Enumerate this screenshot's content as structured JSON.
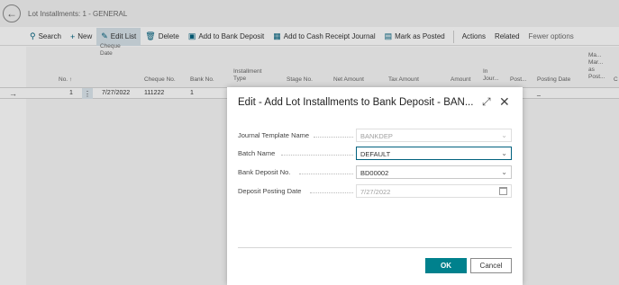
{
  "page": {
    "title": "Lot Installments: 1 - GENERAL",
    "back_icon": "arrow-left-icon"
  },
  "actions": [
    {
      "label": "Search",
      "icon": "⚲"
    },
    {
      "label": "New",
      "icon": "+"
    },
    {
      "label": "Edit List",
      "icon": "✎"
    },
    {
      "label": "Delete",
      "icon": "🗑"
    },
    {
      "label": "Add to Bank Deposit",
      "icon": "▣"
    },
    {
      "label": "Add to Cash Receipt Journal",
      "icon": "▦"
    },
    {
      "label": "Mark as Posted",
      "icon": "▤"
    },
    {
      "label": "Actions"
    },
    {
      "label": "Related"
    },
    {
      "label": "Fewer options"
    }
  ],
  "grid": {
    "columns": [
      "No. ↑",
      "Cheque Date",
      "Cheque No.",
      "Bank No.",
      "Installment Type",
      "Stage No.",
      "Net Amount",
      "Tax Amount",
      "Amount",
      "In Jour...",
      "Post...",
      "Posting Date",
      "Ma... Mar... as Post...",
      "C"
    ],
    "row": {
      "no": "1",
      "cheque_date": "7/27/2022",
      "cheque_no": "111222",
      "bank_no": "1",
      "posting_date": "_"
    }
  },
  "dialog": {
    "title": "Edit - Add Lot Installments to Bank Deposit - BAN...",
    "fields": [
      {
        "label": "Journal Template Name",
        "value": "BANKDEP"
      },
      {
        "label": "Batch Name",
        "value": "DEFAULT"
      },
      {
        "label": "Bank Deposit No.",
        "value": "BD00002"
      },
      {
        "label": "Deposit Posting Date",
        "value": "7/27/2022"
      }
    ],
    "ok_label": "OK",
    "cancel_label": "Cancel"
  },
  "colors": {
    "accent": "#00818d",
    "focus_border": "#00617e"
  }
}
